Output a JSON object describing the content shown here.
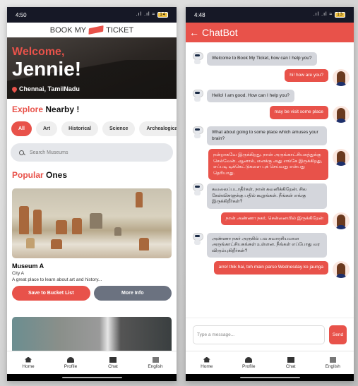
{
  "home": {
    "status": {
      "time": "4:50",
      "battery": "14"
    },
    "logo": {
      "left": "BOOK MY",
      "right": "TICKET"
    },
    "hero": {
      "welcome": "Welcome,",
      "name": "Jennie!",
      "location": "Chennai, TamilNadu"
    },
    "explore": {
      "accent": "Explore",
      "rest": "Nearby !"
    },
    "chips": [
      "All",
      "Art",
      "Historical",
      "Science",
      "Archealogical"
    ],
    "search_placeholder": "Search Museums",
    "popular": {
      "accent": "Popular",
      "rest": "Ones"
    },
    "card": {
      "name": "Museum A",
      "city": "City A",
      "description": "A great place to learn about art and history...",
      "save": "Save to Bucket List",
      "more": "More Info"
    }
  },
  "chat": {
    "status": {
      "time": "4:48",
      "battery": "13"
    },
    "title": "ChatBot",
    "messages": [
      {
        "from": "bot",
        "text": "Welcome to Book My Ticket, how can I help you?"
      },
      {
        "from": "user",
        "text": "hi! how are you?"
      },
      {
        "from": "bot",
        "text": "Hello! I am good. How can I help you?"
      },
      {
        "from": "user",
        "text": "may be visit some place"
      },
      {
        "from": "bot",
        "text": "What about going to some place which amuses your brain?"
      },
      {
        "from": "user",
        "text": "நன்றாகவே இருக்கிறது. நான் அருங்காட்சியகத்துக்கு செல்வேன். ஆனால், எனக்கு அது எங்கே இருக்கிறது, எப்படி டிக்கெட்டுகளை புக் செய்வது என்பது தெரியாது."
      },
      {
        "from": "bot",
        "text": "கவலைப்படாதீர்கள், நான் கவனிக்கிறேன். சில கேள்விகளுக்கு பதில் கூறுங்கள். நீங்கள் எங்கு இருக்கிறீர்கள்?"
      },
      {
        "from": "user",
        "text": "நான் அண்ணா நகர், சென்னையில் இருக்கிறேன்"
      },
      {
        "from": "bot",
        "text": "அண்ணா நகர் அருகில் பல சுவாரசியமான அருங்காட்சியகங்கள் உள்ளன. நீங்கள் எப்போது வர விரும்புகிறீர்கள்?"
      },
      {
        "from": "user",
        "text": "arre! thik hai, toh main parso Wednesday ko jaunga"
      }
    ],
    "input_placeholder": "Type a message...",
    "send": "Send"
  },
  "nav": [
    "Home",
    "Profile",
    "Chat",
    "English"
  ],
  "colors": {
    "accent": "#e8524a",
    "status_bar": "#161826",
    "bot_bubble": "#d4d6dc",
    "secondary_button": "#6b7280"
  }
}
